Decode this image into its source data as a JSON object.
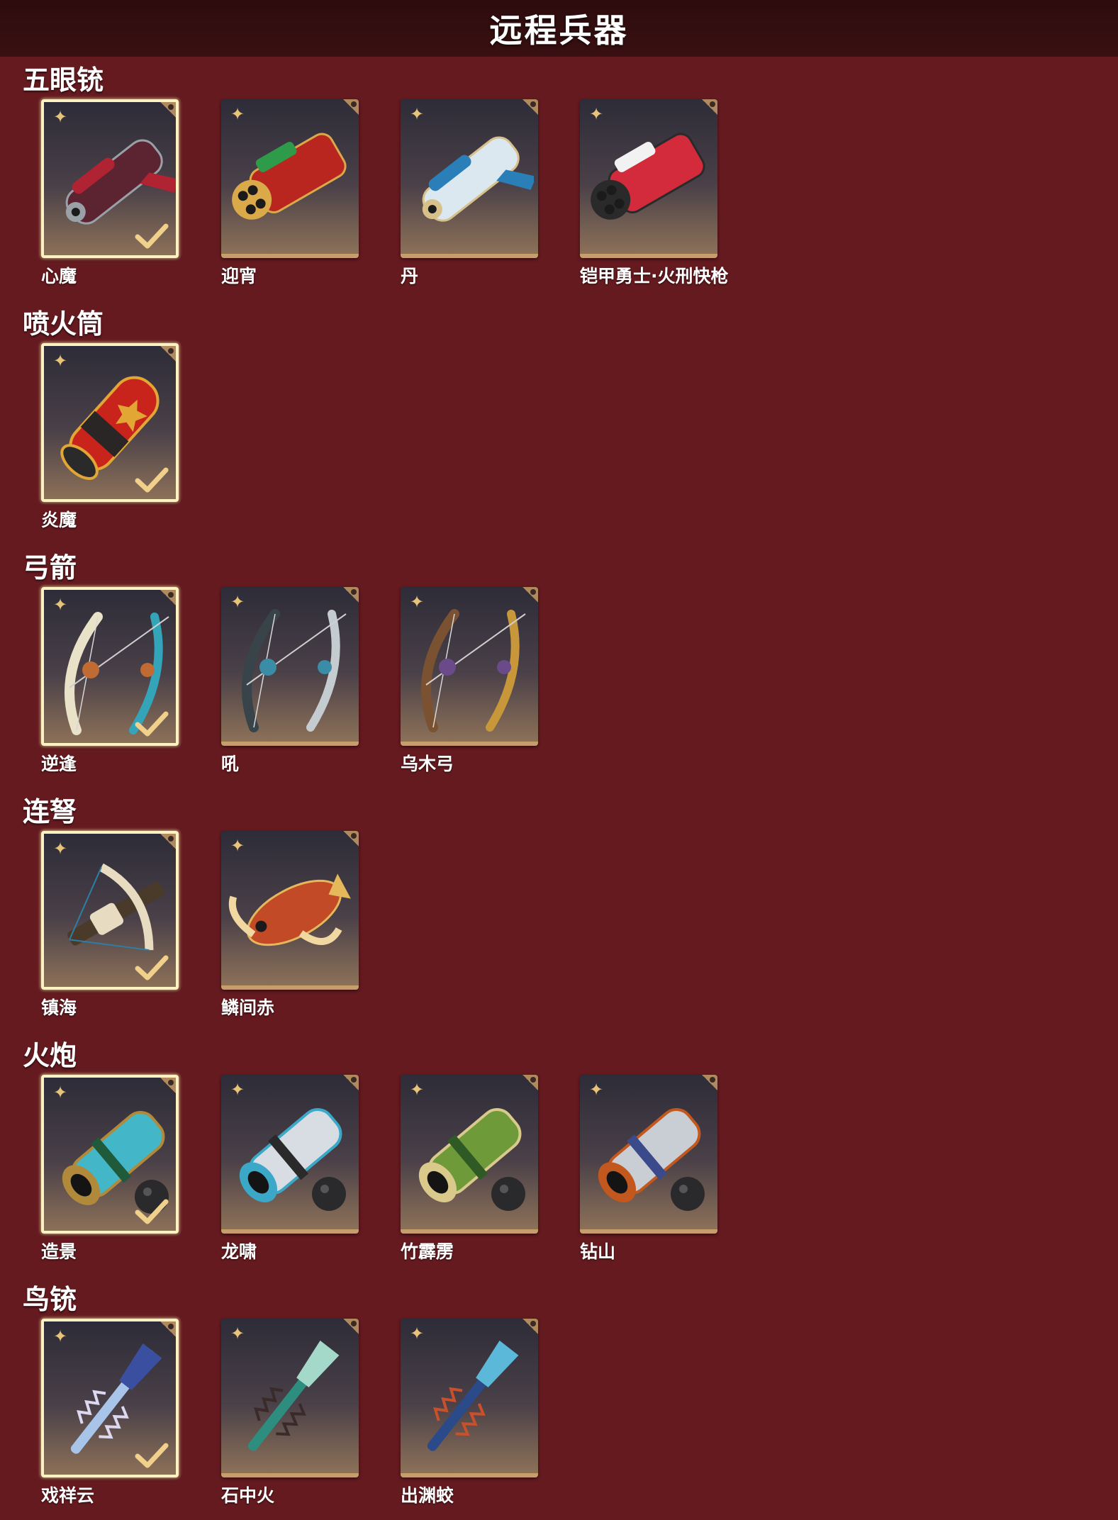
{
  "header": {
    "title": "远程兵器"
  },
  "categories": [
    {
      "name": "五眼铳",
      "items": [
        {
          "name": "心魔",
          "selected": true,
          "art": "xinmo"
        },
        {
          "name": "迎宵",
          "selected": false,
          "art": "yingxiao"
        },
        {
          "name": "丹",
          "selected": false,
          "art": "dan"
        },
        {
          "name": "铠甲勇士·火刑快枪",
          "selected": false,
          "art": "kaijia"
        }
      ]
    },
    {
      "name": "喷火筒",
      "items": [
        {
          "name": "炎魔",
          "selected": true,
          "art": "yanmo"
        }
      ]
    },
    {
      "name": "弓箭",
      "items": [
        {
          "name": "逆逢",
          "selected": true,
          "art": "nifeng"
        },
        {
          "name": "吼",
          "selected": false,
          "art": "hou"
        },
        {
          "name": "乌木弓",
          "selected": false,
          "art": "wumugong"
        }
      ]
    },
    {
      "name": "连弩",
      "items": [
        {
          "name": "镇海",
          "selected": true,
          "art": "zhenhai"
        },
        {
          "name": "鳞间赤",
          "selected": false,
          "art": "linjianchi"
        }
      ]
    },
    {
      "name": "火炮",
      "items": [
        {
          "name": "造景",
          "selected": true,
          "art": "zaojing"
        },
        {
          "name": "龙啸",
          "selected": false,
          "art": "longxiao"
        },
        {
          "name": "竹霹雳",
          "selected": false,
          "art": "zhupili"
        },
        {
          "name": "钻山",
          "selected": false,
          "art": "zuanshan"
        }
      ]
    },
    {
      "name": "鸟铳",
      "items": [
        {
          "name": "戏祥云",
          "selected": true,
          "art": "xixiangyun"
        },
        {
          "name": "石中火",
          "selected": false,
          "art": "shizhonghuo"
        },
        {
          "name": "出渊蛟",
          "selected": false,
          "art": "chuyuanjiao"
        }
      ]
    }
  ],
  "icons": {
    "quality": "quality-star-icon",
    "selected": "checkmark-icon"
  },
  "colors": {
    "background": "#641a1f",
    "header": "#2c0c0d",
    "card_gold": "#c79d6b",
    "selected_border": "#fff2c2",
    "check_gold": "#f0d08a"
  }
}
